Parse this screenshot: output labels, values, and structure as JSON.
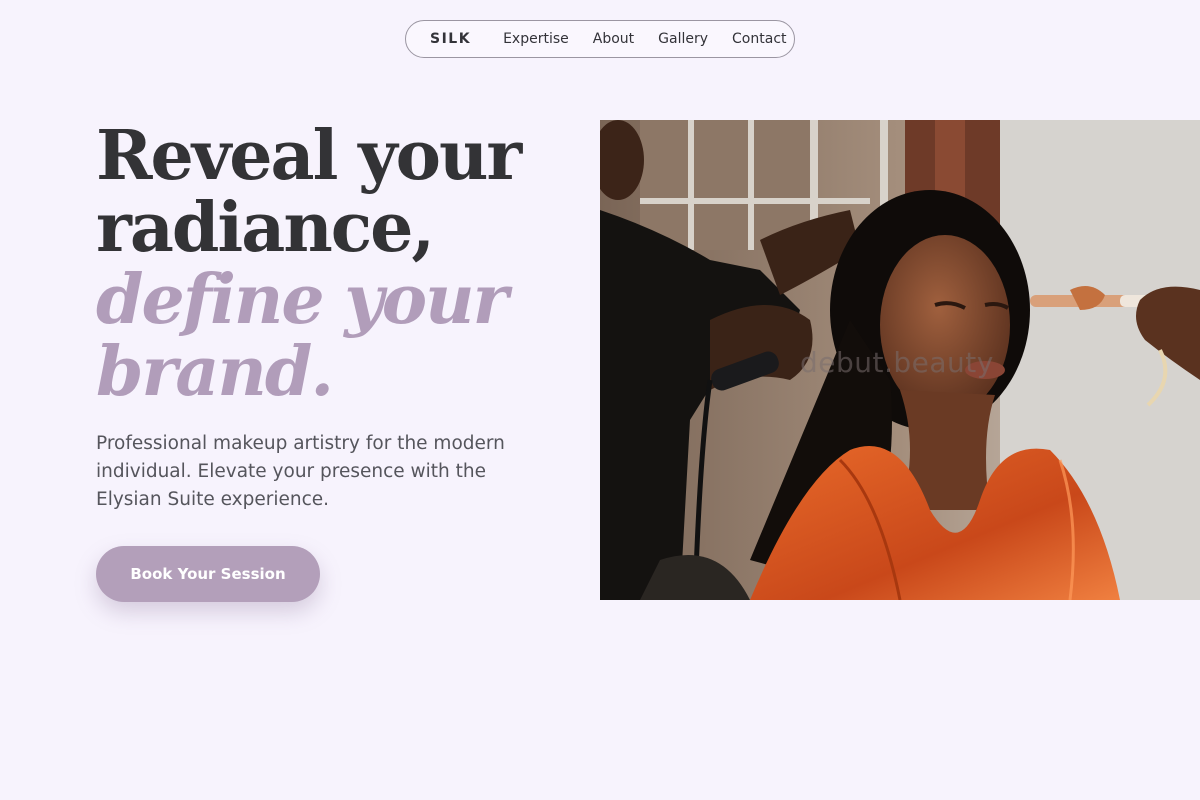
{
  "nav": {
    "brand": "SILK",
    "links": [
      "Expertise",
      "About",
      "Gallery",
      "Contact"
    ]
  },
  "hero": {
    "headline_line1": "Reveal your",
    "headline_line2": "radiance,",
    "headline_line3": "define your",
    "headline_line4": "brand.",
    "subtitle": "Professional makeup artistry for the modern individual. Elevate your presence with the Elysian Suite experience.",
    "cta_label": "Book Your Session",
    "image_watermark": "debut.beauty"
  },
  "colors": {
    "background": "#f7f3fd",
    "accent": "#b19dba",
    "text_dark": "#333336",
    "button": "#b39fba"
  }
}
